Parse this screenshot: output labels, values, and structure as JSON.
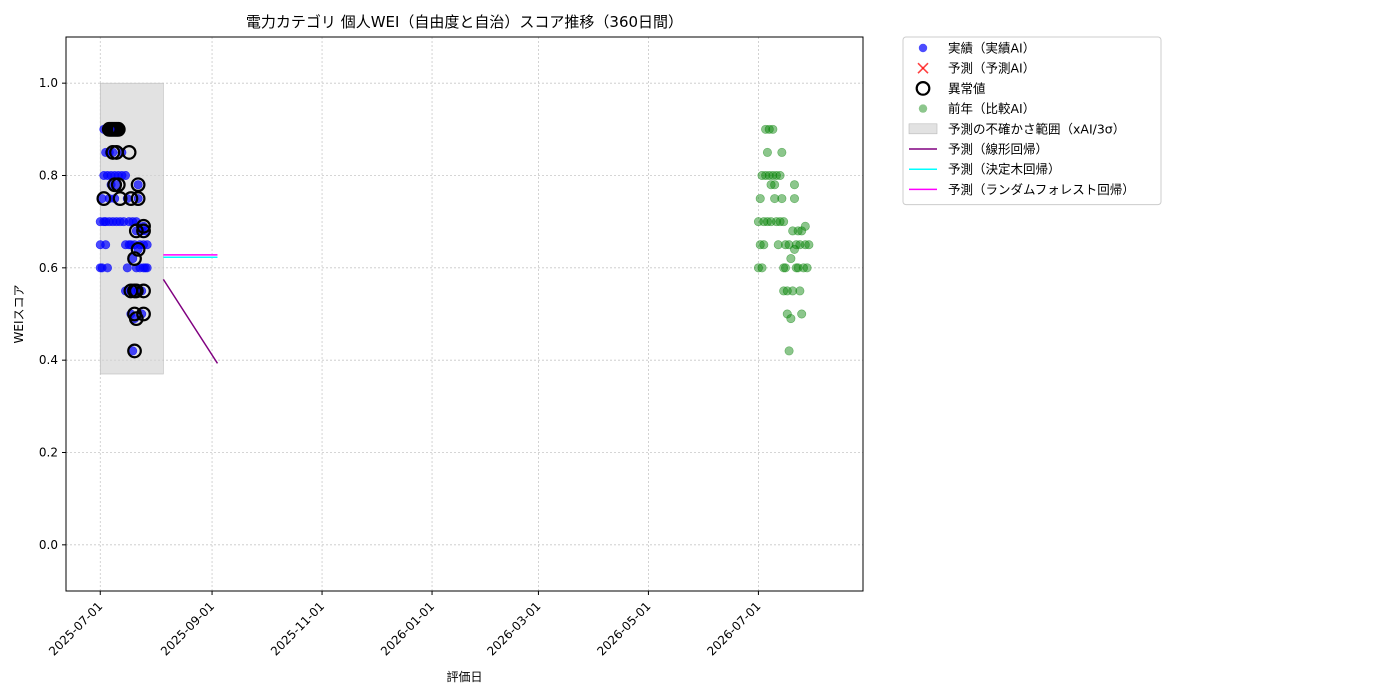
{
  "chart_data": {
    "type": "scatter",
    "title": "電力カテゴリ 個人WEI（自由度と自治）スコア推移（360日間）",
    "xlabel": "評価日",
    "ylabel": "WEIスコア",
    "xlim": [
      "2025-06-12",
      "2026-08-28"
    ],
    "ylim": [
      -0.1,
      1.1
    ],
    "x_ticks": [
      "2025-07-01",
      "2025-09-01",
      "2025-11-01",
      "2026-01-01",
      "2026-03-01",
      "2026-05-01",
      "2026-07-01"
    ],
    "y_ticks": [
      0.0,
      0.2,
      0.4,
      0.6,
      0.8,
      1.0
    ],
    "grid": true,
    "legend_position": "outside-top-right",
    "colors": {
      "actual": "#0000ff",
      "anomaly": "#000000",
      "previous_year": "#008000",
      "band": "#d3d3d3",
      "linear": "#800080",
      "tree": "#00ffff",
      "forest": "#ff00ff"
    },
    "legend": [
      {
        "key": "actual",
        "label": "実績（実績AI）",
        "marker": "dot-blue"
      },
      {
        "key": "predicted",
        "label": "予測（予測AI）",
        "marker": "x-red"
      },
      {
        "key": "anomaly",
        "label": "異常値",
        "marker": "ring-black"
      },
      {
        "key": "previous_year",
        "label": "前年（比較AI）",
        "marker": "dot-green"
      },
      {
        "key": "band",
        "label": "予測の不確かさ範囲（xAI/3σ）",
        "marker": "patch-gray"
      },
      {
        "key": "linear",
        "label": "予測（線形回帰）",
        "marker": "line-purple"
      },
      {
        "key": "tree",
        "label": "予測（決定木回帰）",
        "marker": "line-cyan"
      },
      {
        "key": "forest",
        "label": "予測（ランダムフォレスト回帰）",
        "marker": "line-magenta"
      }
    ],
    "uncertainty_band": {
      "x": [
        "2025-07-01",
        "2025-08-05"
      ],
      "y": [
        0.37,
        1.0
      ]
    },
    "series": [
      {
        "key": "actual",
        "label": "実績（実績AI）",
        "points": [
          [
            "2025-07-01",
            0.6
          ],
          [
            "2025-07-01",
            0.65
          ],
          [
            "2025-07-01",
            0.7
          ],
          [
            "2025-07-02",
            0.75
          ],
          [
            "2025-07-02",
            0.6
          ],
          [
            "2025-07-03",
            0.7
          ],
          [
            "2025-07-03",
            0.8
          ],
          [
            "2025-07-03",
            0.9
          ],
          [
            "2025-07-04",
            0.65
          ],
          [
            "2025-07-04",
            0.85
          ],
          [
            "2025-07-04",
            0.7
          ],
          [
            "2025-07-05",
            0.6
          ],
          [
            "2025-07-05",
            0.8
          ],
          [
            "2025-07-05",
            0.9
          ],
          [
            "2025-07-06",
            0.75
          ],
          [
            "2025-07-06",
            0.7
          ],
          [
            "2025-07-06",
            0.85
          ],
          [
            "2025-07-07",
            0.8
          ],
          [
            "2025-07-07",
            0.78
          ],
          [
            "2025-07-07",
            0.9
          ],
          [
            "2025-07-08",
            0.7
          ],
          [
            "2025-07-08",
            0.85
          ],
          [
            "2025-07-09",
            0.8
          ],
          [
            "2025-07-09",
            0.75
          ],
          [
            "2025-07-09",
            0.9
          ],
          [
            "2025-07-10",
            0.78
          ],
          [
            "2025-07-10",
            0.7
          ],
          [
            "2025-07-11",
            0.8
          ],
          [
            "2025-07-11",
            0.9
          ],
          [
            "2025-07-12",
            0.7
          ],
          [
            "2025-07-13",
            0.8
          ],
          [
            "2025-07-13",
            0.85
          ],
          [
            "2025-07-14",
            0.7
          ],
          [
            "2025-07-15",
            0.65
          ],
          [
            "2025-07-15",
            0.55
          ],
          [
            "2025-07-15",
            0.8
          ],
          [
            "2025-07-16",
            0.75
          ],
          [
            "2025-07-16",
            0.6
          ],
          [
            "2025-07-17",
            0.65
          ],
          [
            "2025-07-17",
            0.7
          ],
          [
            "2025-07-18",
            0.55
          ],
          [
            "2025-07-18",
            0.65
          ],
          [
            "2025-07-18",
            0.5
          ],
          [
            "2025-07-19",
            0.7
          ],
          [
            "2025-07-19",
            0.62
          ],
          [
            "2025-07-19",
            0.42
          ],
          [
            "2025-07-20",
            0.65
          ],
          [
            "2025-07-20",
            0.55
          ],
          [
            "2025-07-20",
            0.49
          ],
          [
            "2025-07-21",
            0.68
          ],
          [
            "2025-07-21",
            0.6
          ],
          [
            "2025-07-21",
            0.7
          ],
          [
            "2025-07-22",
            0.64
          ],
          [
            "2025-07-22",
            0.78
          ],
          [
            "2025-07-22",
            0.55
          ],
          [
            "2025-07-22",
            0.75
          ],
          [
            "2025-07-23",
            0.65
          ],
          [
            "2025-07-23",
            0.6
          ],
          [
            "2025-07-24",
            0.68
          ],
          [
            "2025-07-24",
            0.55
          ],
          [
            "2025-07-24",
            0.5
          ],
          [
            "2025-07-25",
            0.69
          ],
          [
            "2025-07-25",
            0.65
          ],
          [
            "2025-07-25",
            0.6
          ],
          [
            "2025-07-26",
            0.68
          ],
          [
            "2025-07-26",
            0.6
          ],
          [
            "2025-07-27",
            0.65
          ],
          [
            "2025-07-27",
            0.6
          ]
        ]
      },
      {
        "key": "anomaly",
        "label": "異常値",
        "points": [
          [
            "2025-07-03",
            0.75
          ],
          [
            "2025-07-06",
            0.9
          ],
          [
            "2025-07-07",
            0.9
          ],
          [
            "2025-07-08",
            0.9
          ],
          [
            "2025-07-09",
            0.9
          ],
          [
            "2025-07-10",
            0.9
          ],
          [
            "2025-07-11",
            0.9
          ],
          [
            "2025-07-08",
            0.85
          ],
          [
            "2025-07-10",
            0.85
          ],
          [
            "2025-07-09",
            0.78
          ],
          [
            "2025-07-11",
            0.78
          ],
          [
            "2025-07-12",
            0.75
          ],
          [
            "2025-07-17",
            0.85
          ],
          [
            "2025-07-18",
            0.75
          ],
          [
            "2025-07-22",
            0.78
          ],
          [
            "2025-07-22",
            0.75
          ],
          [
            "2025-07-21",
            0.68
          ],
          [
            "2025-07-22",
            0.64
          ],
          [
            "2025-07-25",
            0.69
          ],
          [
            "2025-07-25",
            0.68
          ],
          [
            "2025-07-20",
            0.62
          ],
          [
            "2025-07-18",
            0.55
          ],
          [
            "2025-07-20",
            0.55
          ],
          [
            "2025-07-21",
            0.55
          ],
          [
            "2025-07-25",
            0.55
          ],
          [
            "2025-07-20",
            0.5
          ],
          [
            "2025-07-21",
            0.49
          ],
          [
            "2025-07-25",
            0.5
          ],
          [
            "2025-07-20",
            0.42
          ]
        ]
      },
      {
        "key": "previous_year",
        "label": "前年（比較AI）",
        "points": [
          [
            "2026-07-01",
            0.6
          ],
          [
            "2026-07-01",
            0.7
          ],
          [
            "2026-07-02",
            0.65
          ],
          [
            "2026-07-02",
            0.75
          ],
          [
            "2026-07-03",
            0.6
          ],
          [
            "2026-07-03",
            0.8
          ],
          [
            "2026-07-04",
            0.7
          ],
          [
            "2026-07-04",
            0.65
          ],
          [
            "2026-07-05",
            0.9
          ],
          [
            "2026-07-05",
            0.8
          ],
          [
            "2026-07-06",
            0.85
          ],
          [
            "2026-07-06",
            0.7
          ],
          [
            "2026-07-07",
            0.9
          ],
          [
            "2026-07-07",
            0.8
          ],
          [
            "2026-07-08",
            0.78
          ],
          [
            "2026-07-08",
            0.7
          ],
          [
            "2026-07-09",
            0.9
          ],
          [
            "2026-07-09",
            0.8
          ],
          [
            "2026-07-10",
            0.75
          ],
          [
            "2026-07-10",
            0.78
          ],
          [
            "2026-07-11",
            0.7
          ],
          [
            "2026-07-11",
            0.8
          ],
          [
            "2026-07-12",
            0.65
          ],
          [
            "2026-07-13",
            0.7
          ],
          [
            "2026-07-13",
            0.8
          ],
          [
            "2026-07-14",
            0.85
          ],
          [
            "2026-07-14",
            0.75
          ],
          [
            "2026-07-15",
            0.6
          ],
          [
            "2026-07-15",
            0.55
          ],
          [
            "2026-07-15",
            0.7
          ],
          [
            "2026-07-16",
            0.65
          ],
          [
            "2026-07-16",
            0.6
          ],
          [
            "2026-07-17",
            0.55
          ],
          [
            "2026-07-17",
            0.5
          ],
          [
            "2026-07-18",
            0.65
          ],
          [
            "2026-07-18",
            0.42
          ],
          [
            "2026-07-19",
            0.62
          ],
          [
            "2026-07-19",
            0.49
          ],
          [
            "2026-07-20",
            0.68
          ],
          [
            "2026-07-20",
            0.55
          ],
          [
            "2026-07-21",
            0.64
          ],
          [
            "2026-07-21",
            0.78
          ],
          [
            "2026-07-21",
            0.75
          ],
          [
            "2026-07-22",
            0.65
          ],
          [
            "2026-07-22",
            0.6
          ],
          [
            "2026-07-23",
            0.68
          ],
          [
            "2026-07-23",
            0.6
          ],
          [
            "2026-07-24",
            0.65
          ],
          [
            "2026-07-24",
            0.55
          ],
          [
            "2026-07-25",
            0.68
          ],
          [
            "2026-07-25",
            0.5
          ],
          [
            "2026-07-26",
            0.6
          ],
          [
            "2026-07-27",
            0.69
          ],
          [
            "2026-07-27",
            0.65
          ],
          [
            "2026-07-28",
            0.6
          ],
          [
            "2026-07-29",
            0.65
          ]
        ]
      },
      {
        "key": "linear",
        "label": "予測（線形回帰）",
        "line": [
          [
            "2025-08-05",
            0.575
          ],
          [
            "2025-09-04",
            0.393
          ]
        ]
      },
      {
        "key": "tree",
        "label": "予測（決定木回帰）",
        "line": [
          [
            "2025-08-05",
            0.623
          ],
          [
            "2025-09-04",
            0.623
          ]
        ]
      },
      {
        "key": "forest",
        "label": "予測（ランダムフォレスト回帰）",
        "line": [
          [
            "2025-08-05",
            0.628
          ],
          [
            "2025-09-04",
            0.628
          ]
        ]
      }
    ]
  }
}
